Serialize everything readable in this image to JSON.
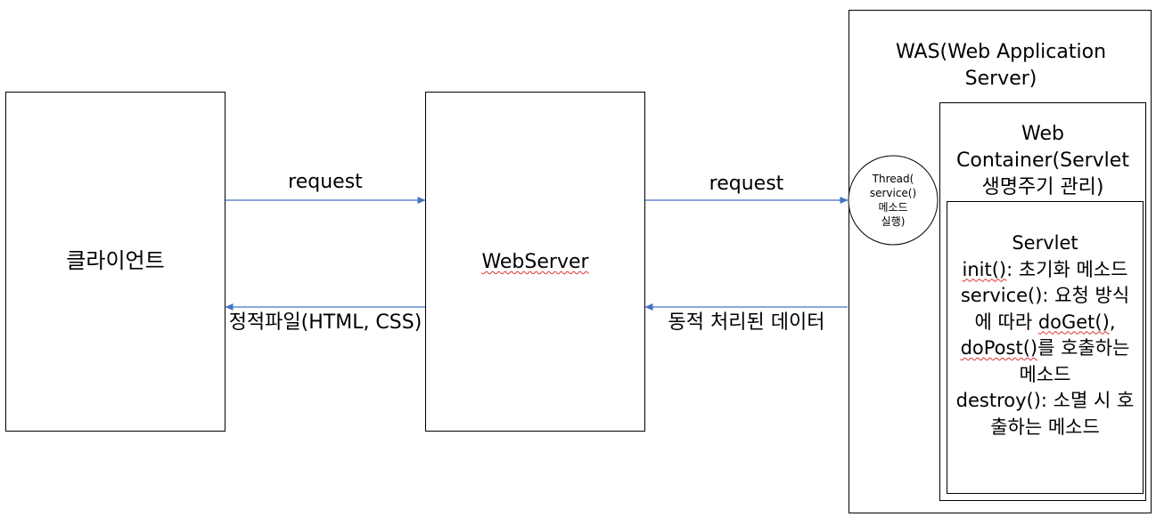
{
  "nodes": {
    "client": {
      "label": "클라이언트"
    },
    "webserver": {
      "label": "WebServer"
    },
    "was": {
      "title": "WAS(Web Application Server)"
    },
    "thread": {
      "line1": "Thread(",
      "line2": "service()",
      "line3": "메소드",
      "line4": "실행)"
    },
    "container": {
      "title": "Web Container(Servlet 생명주기 관리)"
    },
    "servlet": {
      "title": "Servlet",
      "init_name": "init()",
      "init_desc": ": 초기화 메소드",
      "service_text": "service(): 요청 방식에 따라 ",
      "doget": "doGet()",
      "comma": ", ",
      "dopost": "doPost()",
      "service_tail": "를 호출하는 메소드",
      "destroy_text": "destroy(): 소멸 시 호출하는 메소드"
    }
  },
  "edges": {
    "client_to_webserver": "request",
    "webserver_to_client": "정적파일(HTML, CSS)",
    "webserver_to_was": "request",
    "was_to_webserver": "동적 처리된 데이터"
  },
  "colors": {
    "arrow": "#4472c4",
    "border": "#000000"
  }
}
